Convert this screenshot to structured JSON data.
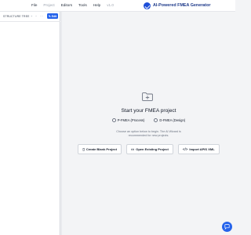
{
  "menu": {
    "items": [
      {
        "label": "File",
        "dim": false
      },
      {
        "label": "Project",
        "dim": true
      },
      {
        "label": "Editors",
        "dim": false
      },
      {
        "label": "Tools",
        "dim": false
      },
      {
        "label": "Help",
        "dim": false
      },
      {
        "label": "v1.0",
        "dim": true
      }
    ]
  },
  "app": {
    "title": "AI-Powered FMEA Generator"
  },
  "sidebar": {
    "header_label": "STRUCTURE TREE",
    "edit_label": "Edit"
  },
  "main": {
    "title": "Start your FMEA project",
    "radio_options": [
      "P-FMEA (Process)",
      "D-FMEA (Design)"
    ],
    "description_line1": "Choose an option below to begin. The AI Wizard is",
    "description_line2": "recommended for new projects.",
    "buttons": [
      "Create Blank Project",
      "Open Existing Project",
      "Import APIS XML"
    ]
  },
  "colors": {
    "accent": "#2563eb",
    "brand": "#1e3a8a"
  }
}
